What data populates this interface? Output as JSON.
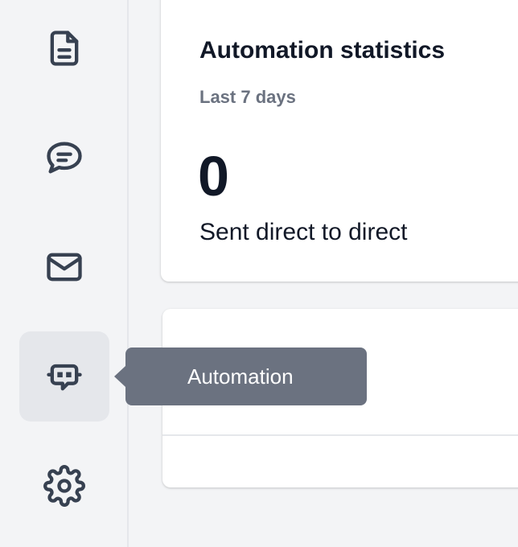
{
  "sidebar": {
    "items": [
      {
        "icon": "document-icon",
        "label": "Documents"
      },
      {
        "icon": "chat-icon",
        "label": "Messages"
      },
      {
        "icon": "mail-icon",
        "label": "Mail"
      },
      {
        "icon": "robot-icon",
        "label": "Automation",
        "active": true
      },
      {
        "icon": "gear-icon",
        "label": "Settings"
      }
    ]
  },
  "tooltip": {
    "text": "Automation"
  },
  "stats_card": {
    "title": "Automation statistics",
    "subtitle": "Last 7 days",
    "value": "0",
    "label": "Sent direct to direct"
  },
  "colors": {
    "background": "#f3f4f6",
    "icon": "#374151",
    "tooltip": "#6b7280",
    "active_item": "#e5e7eb"
  }
}
